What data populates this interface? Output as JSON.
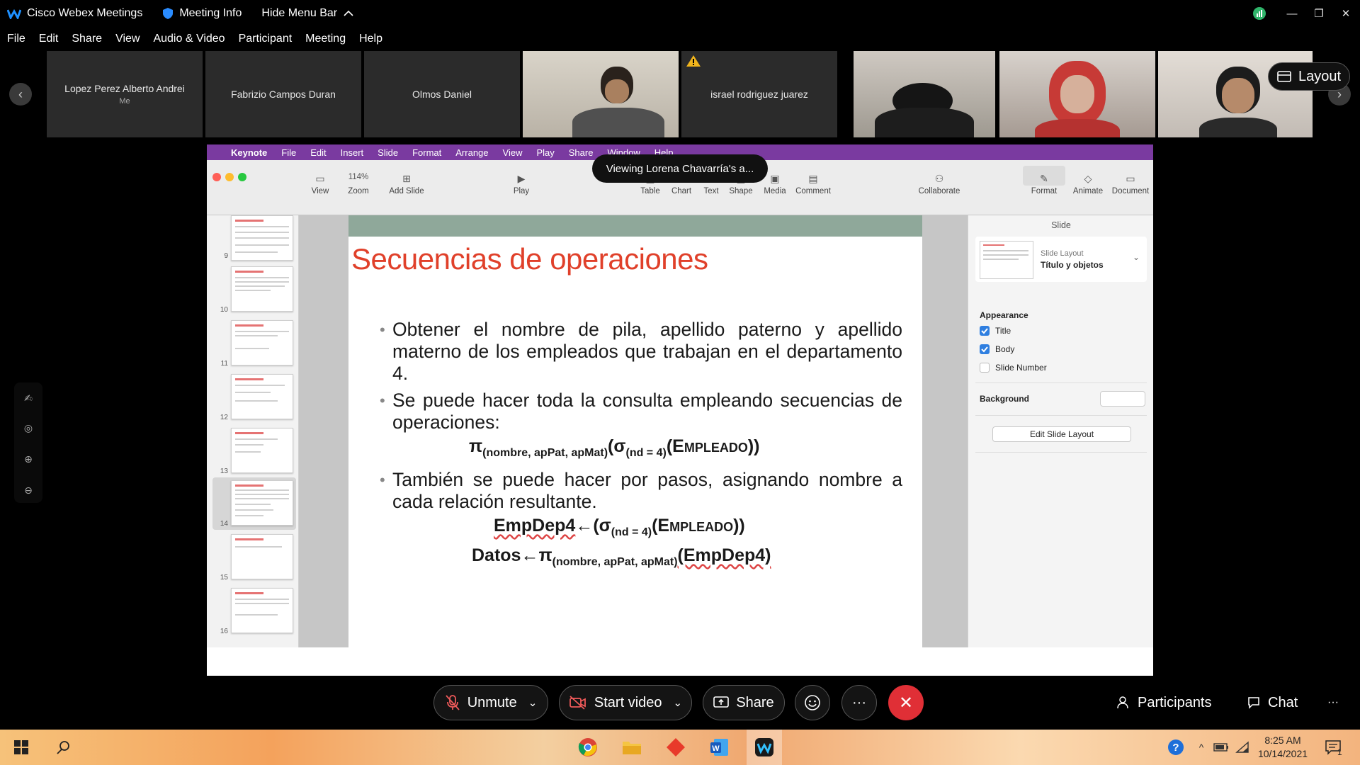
{
  "titlebar": {
    "app_name": "Cisco Webex Meetings",
    "meeting_info": "Meeting Info",
    "hide_menu": "Hide Menu Bar"
  },
  "menubar": {
    "items": [
      "File",
      "Edit",
      "Share",
      "View",
      "Audio & Video",
      "Participant",
      "Meeting",
      "Help"
    ]
  },
  "participants": {
    "tiles": [
      {
        "name": "Lopez Perez Alberto Andrei",
        "sub": "Me"
      },
      {
        "name": "Fabrizio Campos Duran"
      },
      {
        "name": "Olmos Daniel"
      },
      {
        "name": "israel rodriguez juarez"
      }
    ],
    "layout_label": "Layout"
  },
  "share": {
    "viewing_banner": "Viewing Lorena Chavarría's a...",
    "mac_menu": [
      "Keynote",
      "File",
      "Edit",
      "Insert",
      "Slide",
      "Format",
      "Arrange",
      "View",
      "Play",
      "Share",
      "Window",
      "Help"
    ],
    "toolbar": {
      "view": "View",
      "zoom_value": "114%",
      "zoom": "Zoom",
      "add_slide": "Add Slide",
      "play": "Play",
      "table": "Table",
      "chart": "Chart",
      "text": "Text",
      "shape": "Shape",
      "media": "Media",
      "comment": "Comment",
      "collaborate": "Collaborate",
      "format": "Format",
      "animate": "Animate",
      "document": "Document"
    },
    "thumbnails": [
      "9",
      "10",
      "11",
      "12",
      "13",
      "14",
      "15",
      "16"
    ],
    "slide": {
      "title": "Secuencias de operaciones",
      "bullets": [
        "Obtener el nombre de pila, apellido paterno y apellido materno de los empleados que trabajan en el departamento 4.",
        "Se puede hacer toda la consulta empleando secuencias de operaciones:",
        "También se puede hacer por pasos, asignando nombre a cada relación resultante."
      ],
      "formula1": {
        "pi": "π",
        "sub": "(nombre, apPat, apMat)",
        "sigma": "(σ",
        "sub2": "(nd = 4)",
        "rel": "(Empleado))"
      },
      "formula2": {
        "lhs": "EmpDep4",
        "arrow": "←(σ",
        "sub": "(nd = 4)",
        "rel": "(Empleado))"
      },
      "formula3": {
        "lhs": "Datos",
        "arrow": "←π",
        "sub": "(nombre, apPat, apMat)",
        "rel": "(EmpDep4)"
      }
    },
    "inspector": {
      "header": "Slide",
      "layout_label": "Slide Layout",
      "layout_value": "Título y objetos",
      "appearance": "Appearance",
      "title_cb": "Title",
      "body_cb": "Body",
      "slide_number_cb": "Slide Number",
      "background": "Background",
      "edit_layout": "Edit Slide Layout"
    }
  },
  "controls": {
    "unmute": "Unmute",
    "start_video": "Start video",
    "share": "Share",
    "participants": "Participants",
    "chat": "Chat"
  },
  "taskbar": {
    "time": "8:25 AM",
    "date": "10/14/2021",
    "notification_count": "1"
  }
}
